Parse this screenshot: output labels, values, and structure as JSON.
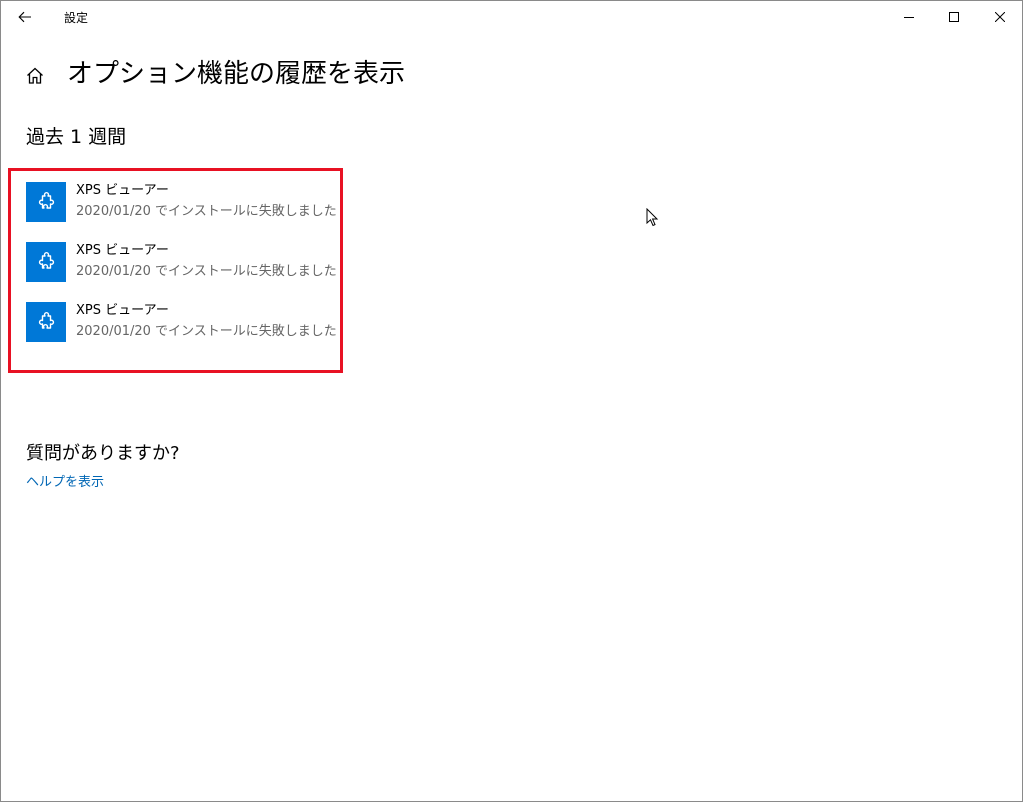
{
  "window": {
    "app_title": "設定",
    "controls": {
      "minimize_icon": "minimize-icon",
      "maximize_icon": "maximize-icon",
      "close_icon": "close-icon"
    }
  },
  "header": {
    "home_icon": "home-icon",
    "title": "オプション機能の履歴を表示"
  },
  "history": {
    "section_title": "過去 1 週間",
    "items": [
      {
        "name": "XPS ビューアー",
        "status": "2020/01/20 でインストールに失敗しました",
        "icon": "puzzle-icon"
      },
      {
        "name": "XPS ビューアー",
        "status": "2020/01/20 でインストールに失敗しました",
        "icon": "puzzle-icon"
      },
      {
        "name": "XPS ビューアー",
        "status": "2020/01/20 でインストールに失敗しました",
        "icon": "puzzle-icon"
      }
    ]
  },
  "help": {
    "heading": "質問がありますか?",
    "link": "ヘルプを表示"
  },
  "colors": {
    "accent": "#0078d7",
    "link": "#0066b4",
    "highlight_border": "#e81123",
    "secondary_text": "#666666"
  }
}
